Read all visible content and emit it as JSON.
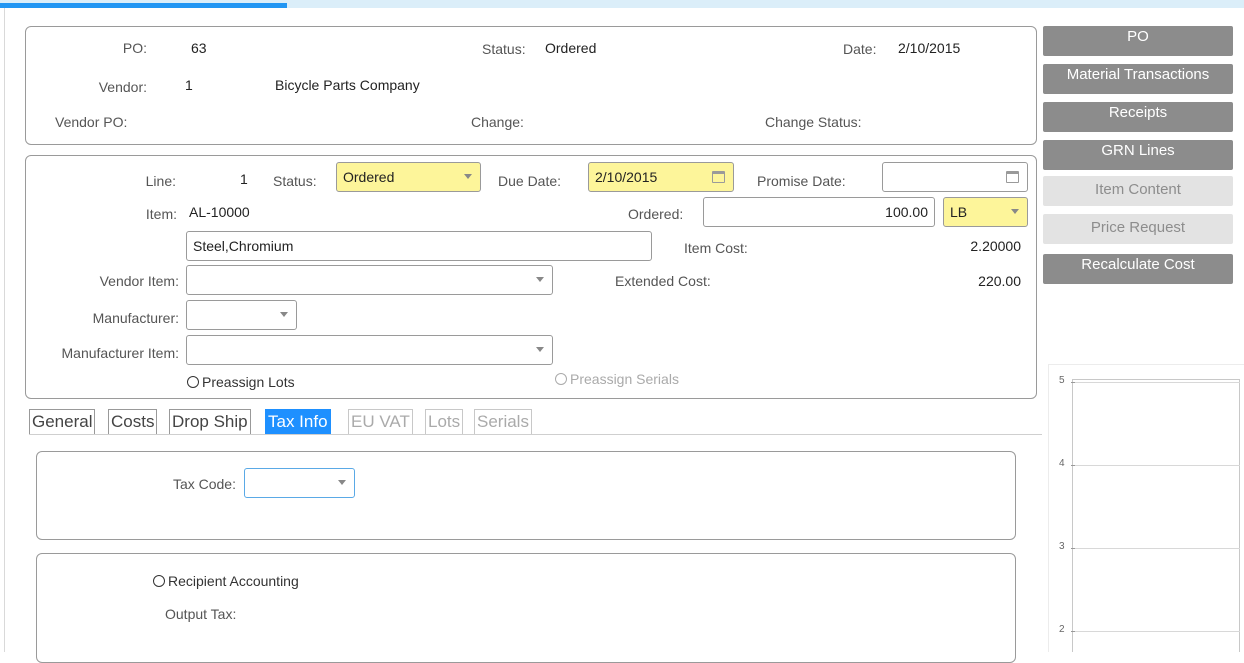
{
  "header": {
    "po_label": "PO:",
    "po_value": "63",
    "status_label": "Status:",
    "status_value": "Ordered",
    "date_label": "Date:",
    "date_value": "2/10/2015",
    "vendor_label": "Vendor:",
    "vendor_id": "1",
    "vendor_name": "Bicycle Parts Company",
    "vendor_po_label": "Vendor PO:",
    "change_label": "Change:",
    "change_status_label": "Change Status:"
  },
  "line": {
    "line_label": "Line:",
    "line_value": "1",
    "status_label": "Status:",
    "status_value": "Ordered",
    "due_date_label": "Due Date:",
    "due_date_value": "2/10/2015",
    "promise_date_label": "Promise Date:",
    "promise_date_value": "",
    "item_label": "Item:",
    "item_value": "AL-10000",
    "ordered_label": "Ordered:",
    "ordered_value": "100.00",
    "uom_value": "LB",
    "description_value": "Steel,Chromium",
    "item_cost_label": "Item Cost:",
    "item_cost_value": "2.20000",
    "vendor_item_label": "Vendor Item:",
    "vendor_item_value": "",
    "extended_cost_label": "Extended Cost:",
    "extended_cost_value": "220.00",
    "manufacturer_label": "Manufacturer:",
    "manufacturer_value": "",
    "manufacturer_item_label": "Manufacturer Item:",
    "manufacturer_item_value": "",
    "preassign_lots_label": "Preassign Lots",
    "preassign_serials_label": "Preassign Serials"
  },
  "tabs": [
    "General",
    "Costs",
    "Drop Ship",
    "Tax Info",
    "EU VAT",
    "Lots",
    "Serials"
  ],
  "tax": {
    "tax_code_label": "Tax Code:",
    "tax_code_value": "",
    "recipient_accounting_label": "Recipient Accounting",
    "output_tax_label": "Output Tax:"
  },
  "sidebar": {
    "buttons": [
      "PO",
      "Material Transactions",
      "Receipts",
      "GRN  Lines",
      "Item Content",
      "Price Request",
      "Recalculate Cost"
    ]
  },
  "chart_data": {
    "type": "bar",
    "categories": [],
    "values": [],
    "y_ticks": [
      "5",
      "4",
      "3",
      "2"
    ],
    "ylim": [
      2,
      5
    ],
    "grid": true
  },
  "colors": {
    "active_tab": "#1e90ff",
    "required_field": "#fdf59a",
    "button_enabled": "#8c8c8c",
    "button_disabled": "#e3e3e3"
  }
}
